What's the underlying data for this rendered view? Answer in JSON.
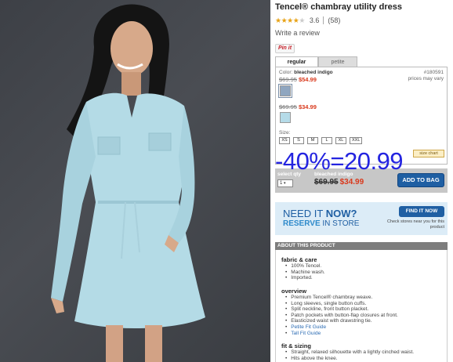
{
  "product": {
    "title": "Tencel® chambray utility dress",
    "rating_value": 3.6,
    "rating_display": "3.6",
    "review_count": "(58)",
    "write_review": "Write a review",
    "pinit": "Pin it"
  },
  "tabs": [
    {
      "label": "regular",
      "active": true
    },
    {
      "label": "petite",
      "active": false
    }
  ],
  "color_section": {
    "label": "Color:",
    "color_name": "bleached indigo",
    "item_number": "#180591",
    "prices_note": "prices may vary",
    "swatches": [
      {
        "old_price": "$69.95",
        "sale_price": "$54.99",
        "selected": true
      },
      {
        "old_price": "$69.95",
        "sale_price": "$34.99",
        "selected": false
      }
    ]
  },
  "size_section": {
    "label": "Size:",
    "sizes": [
      "XS",
      "S",
      "M",
      "L",
      "XL",
      "XXL"
    ],
    "size_chart": "size chart"
  },
  "overlay_text": "-40%=20.99",
  "bag": {
    "qty_label": "select qty",
    "qty_value": "1",
    "color_name": "bleached indigo",
    "old_price": "$69.95",
    "sale_price": "$34.99",
    "add_to_bag": "ADD TO BAG"
  },
  "find_in_store": {
    "need_it": "NEED IT",
    "now": "NOW?",
    "reserve": "RESERVE",
    "in_store": "IN STORE",
    "button": "FIND IT NOW",
    "note": "Check stores near you for this product"
  },
  "about": {
    "header": "ABOUT THIS PRODUCT",
    "sections": [
      {
        "title": "fabric & care",
        "items": [
          {
            "text": "100% Tencel."
          },
          {
            "text": "Machine wash."
          },
          {
            "text": "Imported."
          }
        ]
      },
      {
        "title": "overview",
        "items": [
          {
            "text": "Premium Tencel® chambray weave."
          },
          {
            "text": "Long sleeves, single button cuffs."
          },
          {
            "text": "Split neckline, front button placket."
          },
          {
            "text": "Patch pockets with button-flap closures at front."
          },
          {
            "text": "Elasticized waist with drawstring tie."
          },
          {
            "text": "Petite Fit Guide",
            "link": true
          },
          {
            "text": "Tall Fit Guide",
            "link": true
          }
        ]
      },
      {
        "title": "fit & sizing",
        "items": [
          {
            "text": "Straight, relaxed silhouette with a lightly cinched waist."
          },
          {
            "text": "Hits above the knee."
          }
        ]
      }
    ]
  },
  "colors": {
    "accent_blue": "#1f5fa3",
    "sale_red": "#d9391c",
    "star_gold": "#e8a317",
    "overlay_blue": "#2424e0"
  }
}
